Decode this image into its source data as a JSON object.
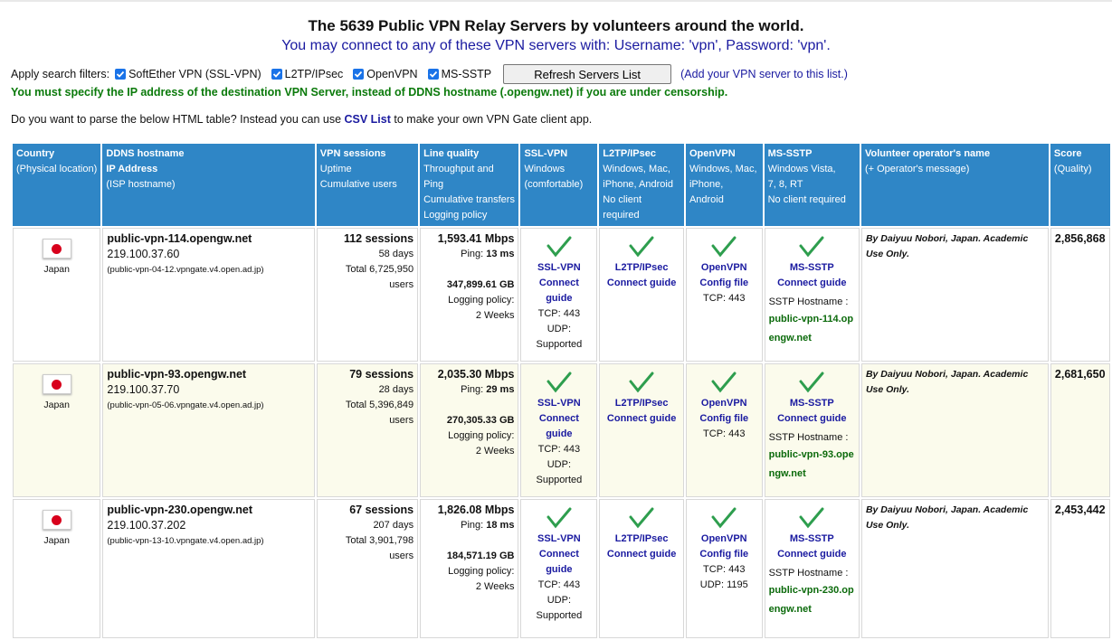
{
  "title": "The 5639 Public VPN Relay Servers by volunteers around the world.",
  "subtitle": "You may connect to any of these VPN servers with: Username: 'vpn', Password: 'vpn'.",
  "filters": {
    "label": "Apply search filters:",
    "options": [
      "SoftEther VPN (SSL-VPN)",
      "L2TP/IPsec",
      "OpenVPN",
      "MS-SSTP"
    ],
    "refresh_label": "Refresh Servers List",
    "add_link": "(Add your VPN server to this list.)"
  },
  "warning": "You must specify the IP address of the destination VPN Server, instead of DDNS hostname (.opengw.net) if you are under censorship.",
  "parse": {
    "before": "Do you want to parse the below HTML table? Instead you can use ",
    "link": "CSV List",
    "after": " to make your own VPN Gate client app."
  },
  "headers": {
    "country": [
      "Country",
      "(Physical location)"
    ],
    "ddns": [
      "DDNS hostname",
      "IP Address",
      "(ISP hostname)"
    ],
    "sessions": [
      "VPN sessions",
      "Uptime",
      "Cumulative users"
    ],
    "quality": [
      "Line quality",
      "Throughput and Ping",
      "Cumulative transfers",
      "Logging policy"
    ],
    "sslvpn": [
      "SSL-VPN",
      "Windows",
      "(comfortable)"
    ],
    "l2tp": [
      "L2TP/IPsec",
      "Windows, Mac,",
      "iPhone, Android",
      "No client required"
    ],
    "openvpn": [
      "OpenVPN",
      "Windows, Mac,",
      "iPhone, Android"
    ],
    "mssstp": [
      "MS-SSTP",
      "Windows Vista,",
      "7, 8, RT",
      "No client required"
    ],
    "operator": [
      "Volunteer operator's name",
      "(+ Operator's message)"
    ],
    "score": [
      "Score",
      "(Quality)"
    ]
  },
  "labels": {
    "ping": "Ping:",
    "logging": "Logging policy:",
    "ssl_name": "SSL-VPN",
    "connect_guide": "Connect guide",
    "l2tp_name": "L2TP/IPsec",
    "openvpn_name": "OpenVPN",
    "config_file": "Config file",
    "sstp_name": "MS-SSTP",
    "sstp_host_label": "SSTP Hostname :",
    "udp_supported": "UDP: Supported"
  },
  "servers": [
    {
      "country": "Japan",
      "host": "public-vpn-114.opengw.net",
      "ip": "219.100.37.60",
      "isp": "(public-vpn-04-12.vpngate.v4.open.ad.jp)",
      "sessions": "112 sessions",
      "uptime": "58 days",
      "users": "Total 6,725,950 users",
      "speed": "1,593.41 Mbps",
      "ping": "13 ms",
      "transfer": "347,899.61 GB",
      "log": "2 Weeks",
      "ssl_tcp": "TCP: 443",
      "ovpn_tcp": "TCP: 443",
      "ovpn_udp": "",
      "sstp_host_a": "public-vpn-114.op",
      "sstp_host_b": "engw.net",
      "operator": "By Daiyuu Nobori, Japan. Academic Use Only.",
      "score": "2,856,868"
    },
    {
      "country": "Japan",
      "host": "public-vpn-93.opengw.net",
      "ip": "219.100.37.70",
      "isp": "(public-vpn-05-06.vpngate.v4.open.ad.jp)",
      "sessions": "79 sessions",
      "uptime": "28 days",
      "users": "Total 5,396,849 users",
      "speed": "2,035.30 Mbps",
      "ping": "29 ms",
      "transfer": "270,305.33 GB",
      "log": "2 Weeks",
      "ssl_tcp": "TCP: 443",
      "ovpn_tcp": "TCP: 443",
      "ovpn_udp": "",
      "sstp_host_a": "public-vpn-93.ope",
      "sstp_host_b": "ngw.net",
      "operator": "By Daiyuu Nobori, Japan. Academic Use Only.",
      "score": "2,681,650"
    },
    {
      "country": "Japan",
      "host": "public-vpn-230.opengw.net",
      "ip": "219.100.37.202",
      "isp": "(public-vpn-13-10.vpngate.v4.open.ad.jp)",
      "sessions": "67 sessions",
      "uptime": "207 days",
      "users": "Total 3,901,798 users",
      "speed": "1,826.08 Mbps",
      "ping": "18 ms",
      "transfer": "184,571.19 GB",
      "log": "2 Weeks",
      "ssl_tcp": "TCP: 443",
      "ovpn_tcp": "TCP: 443",
      "ovpn_udp": "UDP: 1195",
      "sstp_host_a": "public-vpn-230.op",
      "sstp_host_b": "engw.net",
      "operator": "By Daiyuu Nobori, Japan. Academic Use Only.",
      "score": "2,453,442"
    }
  ],
  "colors": {
    "header_bg": "#2f86c6",
    "link": "#1a1aa0",
    "warning": "#0b7a0b",
    "check": "#2e9e4e",
    "alt_row": "#fbfbec"
  }
}
